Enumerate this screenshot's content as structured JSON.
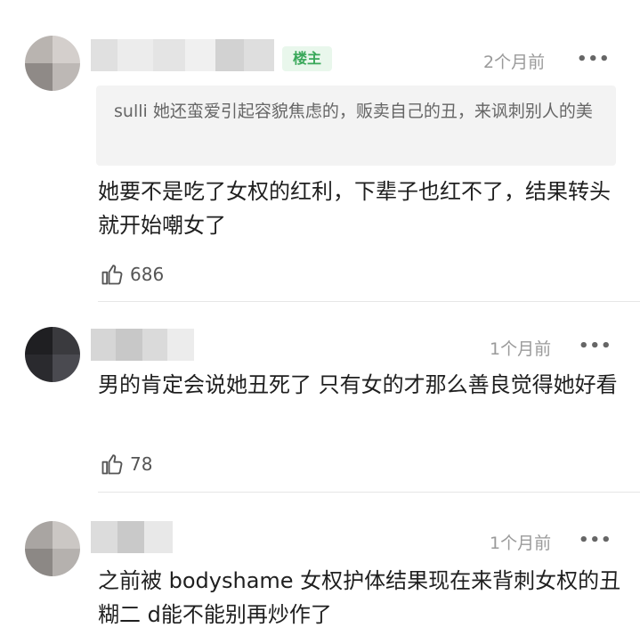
{
  "comments": [
    {
      "badge": "楼主",
      "time": "2个月前",
      "more": "•••",
      "quote": "sulli 她还蛮爱引起容貌焦虑的，贩卖自己的丑，来讽刺别人的美",
      "body": "她要不是吃了女权的红利，下辈子也红不了，结果转头就开始嘲女了",
      "likes": "686"
    },
    {
      "time": "1个月前",
      "more": "•••",
      "body": "男的肯定会说她丑死了 只有女的才那么善良觉得她好看",
      "likes": "78"
    },
    {
      "time": "1个月前",
      "more": "•••",
      "body": "之前被 bodyshame 女权护体结果现在来背刺女权的丑糊二 d能不能别再炒作了"
    }
  ]
}
